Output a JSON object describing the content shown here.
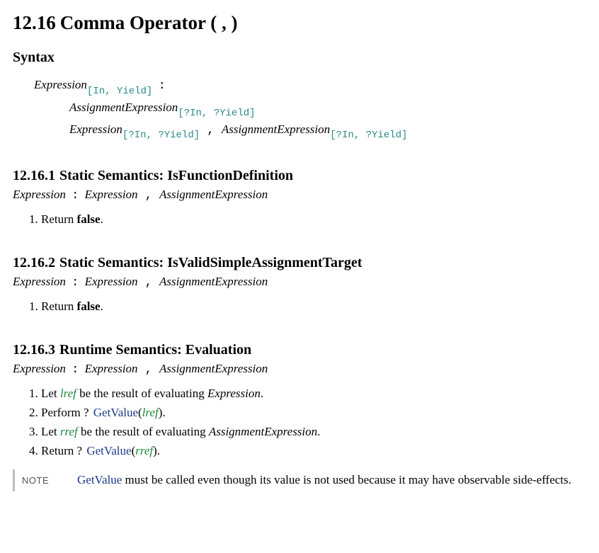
{
  "section": {
    "number": "12.16",
    "title": "Comma Operator ( , )"
  },
  "syntax": {
    "heading": "Syntax",
    "lhs": {
      "nt": "Expression",
      "params": "[In, Yield]",
      "colon": ":"
    },
    "rhs1": {
      "nt1": "AssignmentExpression",
      "params1": "[?In, ?Yield]"
    },
    "rhs2": {
      "nt1": "Expression",
      "params1": "[?In, ?Yield]",
      "comma": ",",
      "nt2": "AssignmentExpression",
      "params2": "[?In, ?Yield]"
    }
  },
  "production_header": {
    "nt1": "Expression",
    "colon": ":",
    "nt2": "Expression",
    "comma": ",",
    "nt3": "AssignmentExpression"
  },
  "sub1": {
    "number": "12.16.1",
    "title": "Static Semantics: IsFunctionDefinition",
    "step1_a": "Return ",
    "step1_b": "false",
    "step1_c": "."
  },
  "sub2": {
    "number": "12.16.2",
    "title": "Static Semantics: IsValidSimpleAssignmentTarget",
    "step1_a": "Return ",
    "step1_b": "false",
    "step1_c": "."
  },
  "sub3": {
    "number": "12.16.3",
    "title": "Runtime Semantics: Evaluation",
    "step1_a": "Let ",
    "step1_var": "lref",
    "step1_b": " be the result of evaluating ",
    "step1_nt": "Expression",
    "step1_c": ".",
    "step2_a": "Perform ",
    "step2_q": "? ",
    "step2_fn": "GetValue",
    "step2_open": "(",
    "step2_var": "lref",
    "step2_close": ").",
    "step3_a": "Let ",
    "step3_var": "rref",
    "step3_b": " be the result of evaluating ",
    "step3_nt": "AssignmentExpression",
    "step3_c": ".",
    "step4_a": "Return ",
    "step4_q": "? ",
    "step4_fn": "GetValue",
    "step4_open": "(",
    "step4_var": "rref",
    "step4_close": ")."
  },
  "note": {
    "label": "NOTE",
    "fn": "GetValue",
    "text": " must be called even though its value is not used because it may have observable side-effects."
  }
}
